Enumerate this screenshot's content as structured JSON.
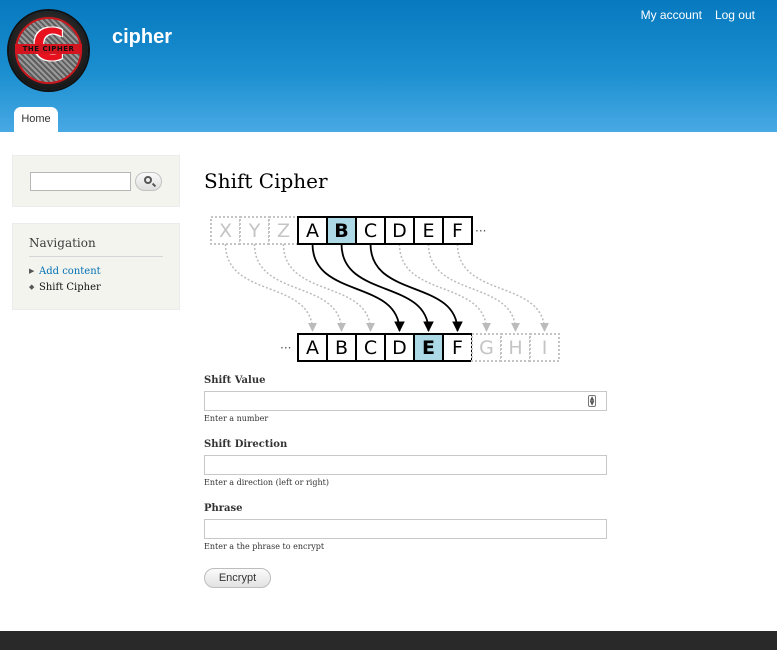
{
  "header": {
    "site_name": "cipher",
    "logo_letter": "C",
    "logo_band_text": "THE CIPHER",
    "secondary_menu": [
      "My account",
      "Log out"
    ],
    "tabs": [
      "Home"
    ]
  },
  "sidebar": {
    "search": {
      "placeholder": ""
    },
    "navigation": {
      "title": "Navigation",
      "items": [
        "Add content",
        "Shift Cipher"
      ]
    }
  },
  "main": {
    "title": "Shift Cipher",
    "diagram": {
      "top_row": [
        "X",
        "Y",
        "Z",
        "A",
        "B",
        "C",
        "D",
        "E",
        "F"
      ],
      "bottom_row": [
        "A",
        "B",
        "C",
        "D",
        "E",
        "F",
        "G",
        "H",
        "I"
      ],
      "highlight_color": "#add8e6"
    },
    "form": {
      "fields": [
        {
          "label": "Shift Value",
          "value": "",
          "description": "Enter a number"
        },
        {
          "label": "Shift Direction",
          "value": "",
          "description": "Enter a direction (left or right)"
        },
        {
          "label": "Phrase",
          "value": "",
          "description": "Enter a the phrase to encrypt"
        }
      ],
      "submit_label": "Encrypt"
    }
  },
  "colors": {
    "header_top": "#0779bf",
    "header_bottom": "#48a9e4",
    "link": "#0071b3",
    "footer": "#292929"
  }
}
